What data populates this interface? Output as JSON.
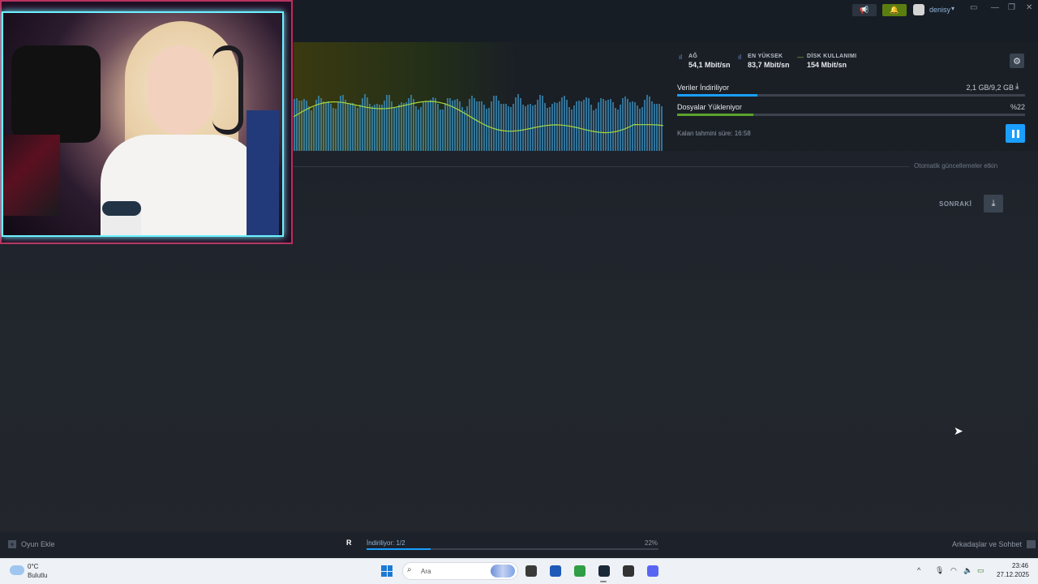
{
  "titlebar": {
    "megaphone_icon": "megaphone-icon",
    "bell_icon": "bell-icon",
    "username": "denisy",
    "caret": "▾",
    "window_controls": [
      "▭",
      "—",
      "❐",
      "✕"
    ]
  },
  "download_header": {
    "stats": [
      {
        "label": "AĞ",
        "value": "54,1 Mbit/sn",
        "color": "#6a8fd8"
      },
      {
        "label": "EN YÜKSEK",
        "value": "83,7 Mbit/sn",
        "color": "#6a8fd8"
      },
      {
        "label": "DİSK KULLANIMI",
        "value": "154 Mbit/sn",
        "color": "#80c242"
      }
    ],
    "rows": [
      {
        "title": "Veriler İndiriliyor",
        "right": "2,1 GB/9,2 GB",
        "progress": 0.23,
        "color": "#1a9fff"
      },
      {
        "title": "Dosyalar Yükleniyor",
        "right": "%22",
        "progress": 0.22,
        "color": "#5ba32b"
      }
    ],
    "eta": "Kalan tahmini süre: 16:58",
    "graph": {
      "line_color": "#a7d93d",
      "bar_color": "#3b8fbf"
    }
  },
  "queue": {
    "auto_updates": "Otomatik güncellemeler etkin",
    "next_label": "SONRAKİ"
  },
  "steam_bottom": {
    "add_game": "Oyun Ekle",
    "download_status": "İndiriliyor: 1/2",
    "download_percent": "22%",
    "download_progress": 0.22,
    "friends_chat": "Arkadaşlar ve Sohbet"
  },
  "taskbar": {
    "weather_temp": "0°C",
    "weather_condition": "Bulutlu",
    "search_placeholder": "Ara",
    "time": "23:46",
    "date": "27.12.2025",
    "apps": [
      {
        "name": "file-explorer-icon",
        "color": "#3a3a3a"
      },
      {
        "name": "store-icon",
        "color": "#1e5bb8"
      },
      {
        "name": "chrome-icon",
        "color": "#2f9e44"
      },
      {
        "name": "steam-icon",
        "color": "#1b2838"
      },
      {
        "name": "app-icon",
        "color": "#333"
      },
      {
        "name": "discord-icon",
        "color": "#5865f2"
      }
    ]
  }
}
